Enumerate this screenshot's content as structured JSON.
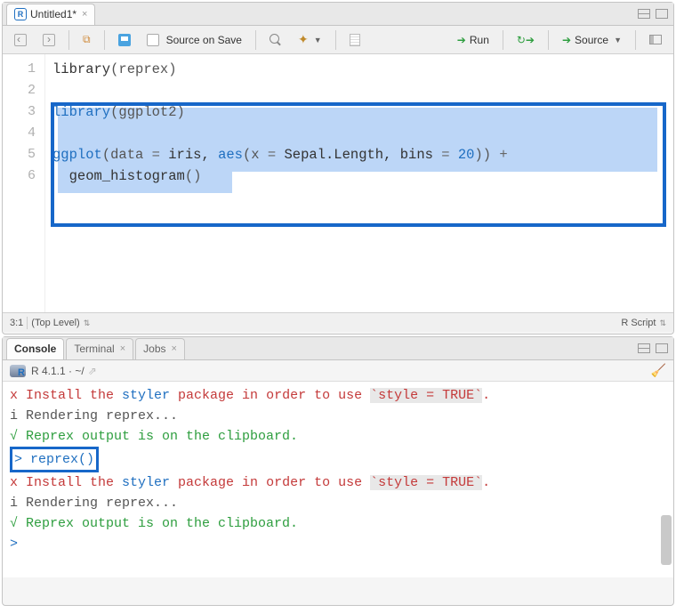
{
  "editor": {
    "tab_title": "Untitled1*",
    "source_on_save_label": "Source on Save",
    "run_label": "Run",
    "source_label": "Source",
    "gutter": [
      "1",
      "2",
      "3",
      "4",
      "5",
      "6"
    ],
    "code": {
      "l1a": "library",
      "l1b": "(reprex)",
      "l3a": "library",
      "l3b": "(ggplot2)",
      "l5a": "ggplot",
      "l5b": "(data ",
      "l5c": "=",
      "l5d": " iris, ",
      "l5e": "aes",
      "l5f": "(x ",
      "l5g": "=",
      "l5h": " Sepal.Length, bins ",
      "l5i": "=",
      "l5j": " ",
      "l5k": "20",
      "l5l": ")) ",
      "l5m": "+",
      "l6a": "  geom_histogram",
      "l6b": "()"
    },
    "status_pos": "3:1",
    "status_scope": "(Top Level)",
    "status_lang": "R Script"
  },
  "console": {
    "tabs": {
      "console": "Console",
      "terminal": "Terminal",
      "jobs": "Jobs"
    },
    "session": "R 4.1.1 · ~/",
    "lines": {
      "x1_pre": "x Install the ",
      "x1_hl": "styler",
      "x1_mid": " package in order to use ",
      "x1_code": "`style = TRUE`",
      "x1_post": ".",
      "i1": "i Rendering reprex...",
      "ok1": "√ Reprex output is on the clipboard.",
      "p1": "> ",
      "p1_cmd": "reprex()",
      "x2_pre": "x Install the ",
      "x2_hl": "styler",
      "x2_mid": " package in order to use ",
      "x2_code": "`style = TRUE`",
      "x2_post": ".",
      "i2": "i Rendering reprex...",
      "ok2": "√ Reprex output is on the clipboard.",
      "p2": "> "
    }
  }
}
